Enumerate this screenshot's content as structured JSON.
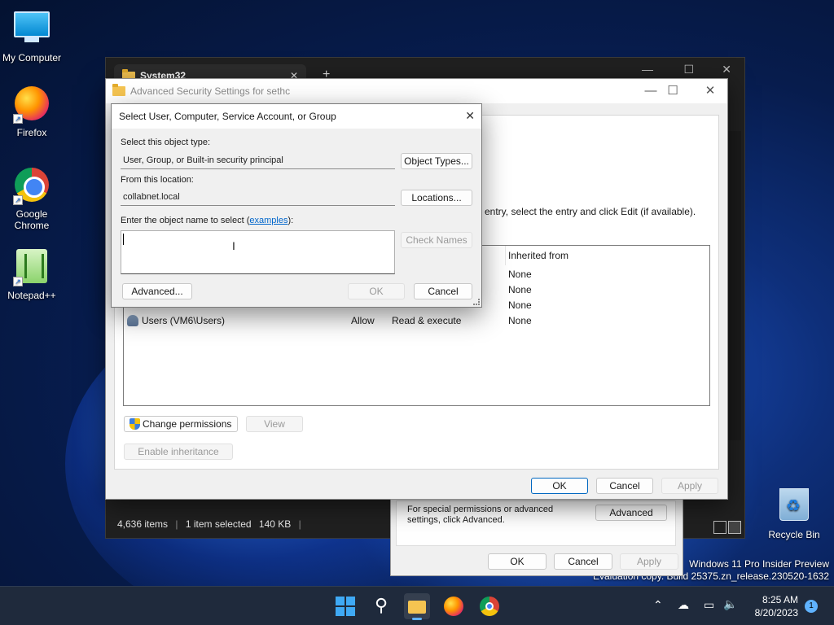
{
  "desktop": {
    "icons": [
      {
        "label": "My Computer"
      },
      {
        "label": "Firefox"
      },
      {
        "label": "Google Chrome"
      },
      {
        "label": "Notepad++"
      },
      {
        "label": "Recycle Bin"
      }
    ],
    "watermark": {
      "line1": "Windows 11 Pro Insider Preview",
      "line2": "Evaluation copy. Build 25375.zn_release.230520-1632"
    }
  },
  "explorer": {
    "tab_title": "System32",
    "new_tab_glyph": "+",
    "status": {
      "items": "4,636 items",
      "selected": "1 item selected",
      "size": "140 KB"
    }
  },
  "advanced_security": {
    "title": "Advanced Security Settings for sethc",
    "instruction_fragment": "entry, select the entry and click Edit (if available).",
    "table": {
      "column_inherited": "Inherited from",
      "rows": [
        {
          "inherited": "None"
        },
        {
          "inherited": "None"
        },
        {
          "inherited": "None"
        },
        {
          "principal": "Users (VM6\\Users)",
          "type": "Allow",
          "access": "Read & execute",
          "inherited": "None"
        }
      ]
    },
    "buttons": {
      "change_permissions": "Change permissions",
      "view": "View",
      "enable_inheritance": "Enable inheritance",
      "ok": "OK",
      "cancel": "Cancel",
      "apply": "Apply"
    }
  },
  "properties": {
    "note": "For special permissions or advanced settings, click Advanced.",
    "advanced": "Advanced",
    "ok": "OK",
    "cancel": "Cancel",
    "apply": "Apply"
  },
  "select_dialog": {
    "title": "Select User, Computer, Service Account, or Group",
    "object_type_label": "Select this object type:",
    "object_type_value": "User, Group, or Built-in security principal",
    "object_types_button": "Object Types...",
    "location_label": "From this location:",
    "location_value": "collabnet.local",
    "locations_button": "Locations...",
    "name_label_prefix": "Enter the object name to select (",
    "name_label_link": "examples",
    "name_label_suffix": "):",
    "check_names_button": "Check Names",
    "advanced_button": "Advanced...",
    "ok_button": "OK",
    "cancel_button": "Cancel",
    "close_glyph": "✕"
  },
  "taskbar": {
    "time": "8:25 AM",
    "date": "8/20/2023",
    "notification_count": "1"
  }
}
